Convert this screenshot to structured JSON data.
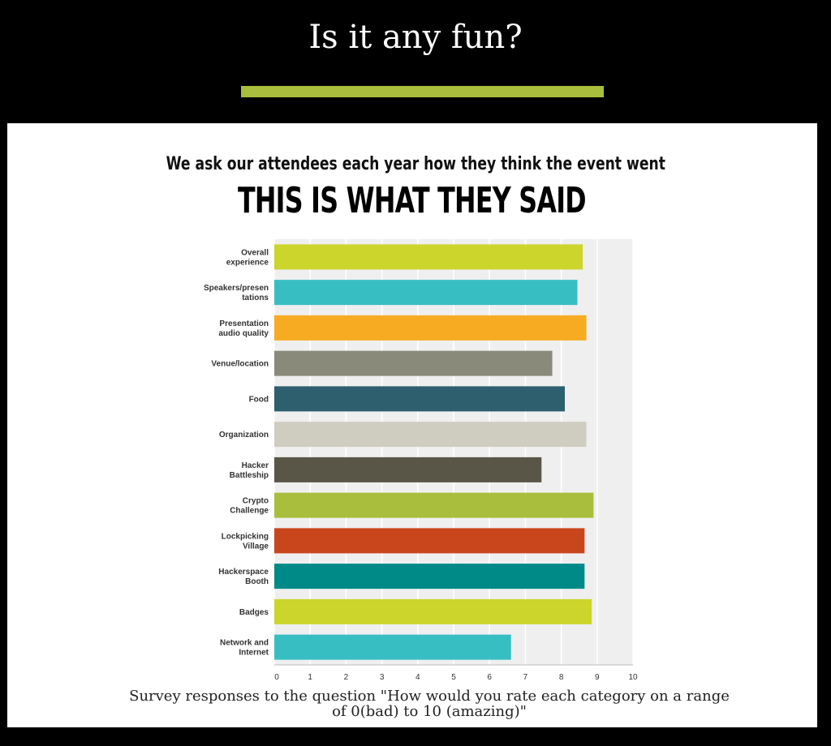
{
  "header": {
    "title": "Is it any fun?",
    "accent_color": "#a8be3c"
  },
  "panel": {
    "intro": "We ask our attendees each year how they think the event went",
    "headline": "THIS IS WHAT THEY SAID",
    "caption_line1": "Survey responses to the question \"How would you rate each category on a range",
    "caption_line2": "of 0(bad) to 10 (amazing)\""
  },
  "chart_data": {
    "type": "bar",
    "orientation": "horizontal",
    "title": "",
    "xlabel": "",
    "ylabel": "",
    "xlim": [
      0,
      10
    ],
    "ticks": [
      "0",
      "1",
      "2",
      "3",
      "4",
      "5",
      "6",
      "7",
      "8",
      "9",
      "10"
    ],
    "grid": true,
    "categories": [
      [
        "Overall",
        "experience"
      ],
      [
        "Speakers/presen",
        "tations"
      ],
      [
        "Presentation",
        "audio quality"
      ],
      [
        "Venue/location"
      ],
      [
        "Food"
      ],
      [
        "Organization"
      ],
      [
        "Hacker",
        "Battleship"
      ],
      [
        "Crypto",
        "Challenge"
      ],
      [
        "Lockpicking",
        "Village"
      ],
      [
        "Hackerspace",
        "Booth"
      ],
      [
        "Badges"
      ],
      [
        "Network and",
        "Internet"
      ]
    ],
    "values": [
      8.6,
      8.45,
      8.7,
      7.75,
      8.1,
      8.7,
      7.45,
      8.9,
      8.65,
      8.65,
      8.85,
      6.6
    ],
    "colors": [
      "#ccd52b",
      "#37bec3",
      "#f7ab22",
      "#8a8a7a",
      "#2d5f6e",
      "#cfcdbf",
      "#595648",
      "#a8be3c",
      "#c9461c",
      "#008a87",
      "#ccd52b",
      "#37bec3"
    ]
  }
}
